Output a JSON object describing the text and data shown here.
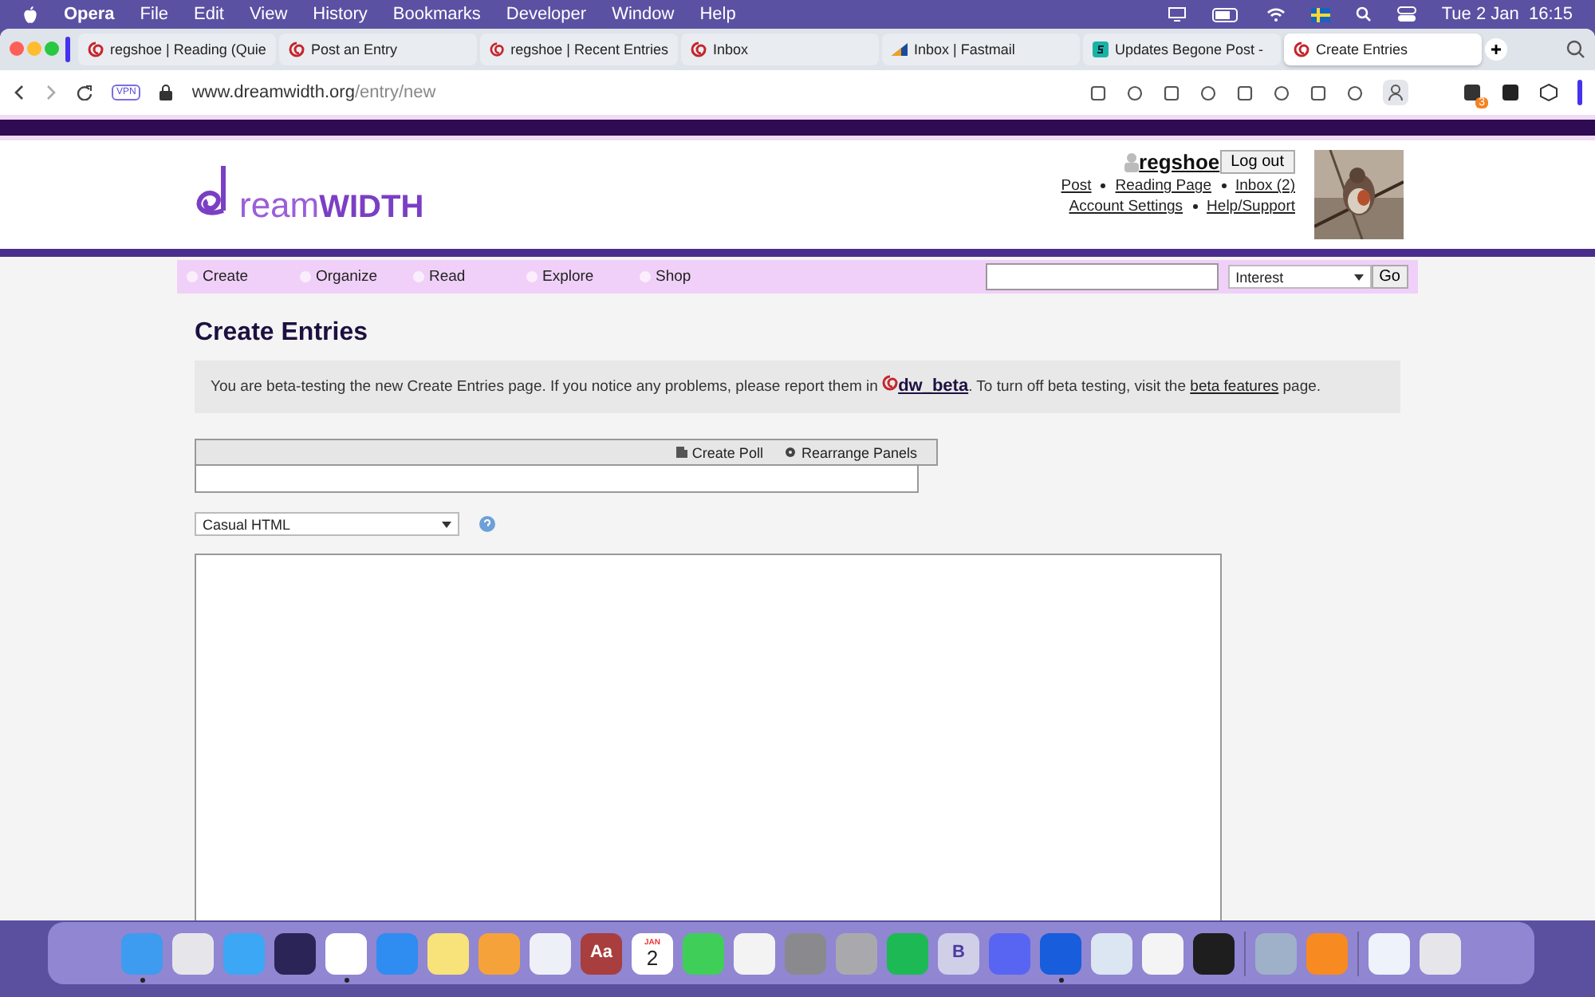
{
  "menubar": {
    "app": "Opera",
    "items": [
      "File",
      "Edit",
      "View",
      "History",
      "Bookmarks",
      "Developer",
      "Window",
      "Help"
    ],
    "clock": "Tue 2 Jan  16:15"
  },
  "tabs": [
    {
      "label": "regshoe | Reading (Quie",
      "selected": false,
      "kind": "dw"
    },
    {
      "label": "Post an Entry",
      "selected": false,
      "kind": "dw"
    },
    {
      "label": "regshoe | Recent Entries",
      "selected": false,
      "kind": "dw"
    },
    {
      "label": "Inbox",
      "selected": false,
      "kind": "dw"
    },
    {
      "label": "Inbox | Fastmail",
      "selected": false,
      "kind": "fastmail"
    },
    {
      "label": "Updates Begone Post -",
      "selected": false,
      "kind": "s"
    },
    {
      "label": "Create Entries",
      "selected": true,
      "kind": "dw"
    }
  ],
  "address": {
    "badge": "VPN",
    "host": "www.dreamwidth.org",
    "path": "/entry/new"
  },
  "extension_badge": "3",
  "site": {
    "logo_a": "ream",
    "logo_b": "WIDTH",
    "user": "regshoe",
    "logout": "Log out",
    "links": [
      "Post",
      "Reading Page",
      "Inbox (2)",
      "Account Settings",
      "Help/Support"
    ],
    "nav": [
      "Create",
      "Organize",
      "Read",
      "Explore",
      "Shop"
    ],
    "search_type": "Interest",
    "go": "Go"
  },
  "page": {
    "title": "Create Entries",
    "notice": {
      "before": "You are beta-testing the new Create Entries page. If you notice any problems, please report them in ",
      "community": "dw_beta",
      "middle": ". To turn off beta testing, visit the ",
      "link": "beta features",
      "after": " page."
    },
    "panel_actions": [
      "Create Poll",
      "Rearrange Panels"
    ],
    "format": "Casual HTML"
  },
  "dock": [
    {
      "running": true
    },
    {
      "running": false
    },
    {
      "running": false
    },
    {
      "running": false
    },
    {
      "running": true
    },
    {
      "running": false
    },
    {
      "running": false
    },
    {
      "running": false
    },
    {
      "running": false
    },
    {
      "running": false,
      "text": "Aa"
    },
    {
      "running": false,
      "text": "JAN",
      "text2": "2"
    },
    {
      "running": false
    },
    {
      "running": false
    },
    {
      "running": false
    },
    {
      "running": false
    },
    {
      "running": false
    },
    {
      "running": false,
      "text": "B"
    },
    {
      "running": false
    },
    {
      "running": true
    },
    {
      "running": false
    },
    {
      "running": false
    },
    {
      "running": false
    },
    {
      "running": false
    },
    {
      "running": false
    },
    {
      "running": false
    },
    {
      "running": false
    }
  ]
}
